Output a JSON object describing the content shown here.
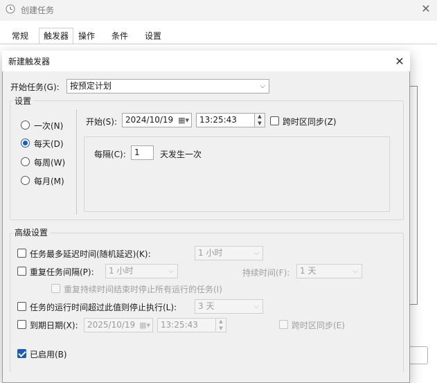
{
  "background_window": {
    "title": "创建任务",
    "close_glyph": "✕",
    "tabs": [
      {
        "label": "常规",
        "active": false
      },
      {
        "label": "触发器",
        "active": true
      },
      {
        "label": "操作",
        "active": false
      },
      {
        "label": "条件",
        "active": false
      },
      {
        "label": "设置",
        "active": false
      }
    ]
  },
  "dialog": {
    "title": "新建触发器",
    "close_glyph": "✕",
    "begin_task": {
      "label": "开始任务(G):",
      "value": "按预定计划"
    },
    "settings": {
      "group_title": "设置",
      "schedule_options": [
        {
          "label": "一次(N)",
          "selected": false
        },
        {
          "label": "每天(D)",
          "selected": true
        },
        {
          "label": "每周(W)",
          "selected": false
        },
        {
          "label": "每月(M)",
          "selected": false
        }
      ],
      "start_label": "开始(S):",
      "start_date": "2024/10/19",
      "start_time": "13:25:43",
      "sync_timezone_label": "跨时区同步(Z)",
      "sync_timezone_checked": false,
      "recur_label": "每隔(C):",
      "recur_value": "1",
      "recur_suffix": "天发生一次"
    },
    "advanced": {
      "group_title": "高级设置",
      "delay_label": "任务最多延迟时间(随机延迟)(K):",
      "delay_value": "1 小时",
      "repeat_label": "重复任务间隔(P):",
      "repeat_value": "1 小时",
      "duration_label": "持续时间(F):",
      "duration_value": "1 天",
      "stop_all_label": "重复持续时间结束时停止所有运行的任务(I)",
      "stop_if_longer_label": "任务的运行时间超过此值则停止执行(L):",
      "stop_if_longer_value": "3 天",
      "expire_label": "到期日期(X):",
      "expire_date": "2025/10/19",
      "expire_time": "13:25:43",
      "expire_sync_label": "跨时区同步(E)",
      "enabled_label": "已启用(B)",
      "enabled_checked": true
    }
  },
  "icons": {
    "app": "task-scheduler-icon",
    "calendar": "calendar-icon",
    "chevron": "chevron-down-icon"
  },
  "colors": {
    "accent": "#1c5bb8",
    "dialog_bg": "#f0f0f0",
    "disabled_text": "#a0a0a0"
  }
}
